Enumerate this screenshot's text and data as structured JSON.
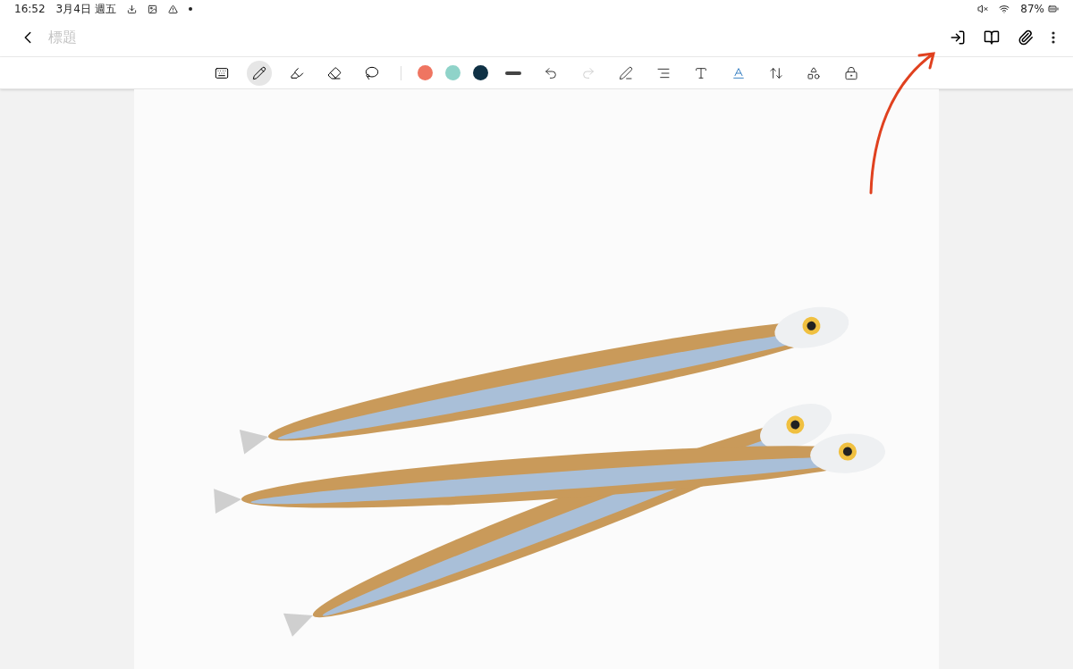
{
  "status_bar": {
    "time": "16:52",
    "date": "3月4日 週五",
    "battery": "87%"
  },
  "header": {
    "title_placeholder": "標題"
  },
  "toolbar": {
    "tools": [
      {
        "kind": "keyboard",
        "selected": false
      },
      {
        "kind": "pen",
        "selected": true
      },
      {
        "kind": "highlighter",
        "selected": false
      },
      {
        "kind": "eraser",
        "selected": false
      },
      {
        "kind": "lasso",
        "selected": false
      }
    ],
    "colors": [
      {
        "color": "#ef7561",
        "selected": false
      },
      {
        "color": "#8fd3c9",
        "selected": false
      },
      {
        "color": "#0f3145",
        "selected": false
      }
    ],
    "actions": [
      {
        "kind": "stroke",
        "disabled": false
      },
      {
        "kind": "undo",
        "disabled": false
      },
      {
        "kind": "redo",
        "disabled": true
      },
      {
        "kind": "pen-settings",
        "disabled": false
      },
      {
        "kind": "align",
        "disabled": false
      },
      {
        "kind": "handwriting",
        "disabled": false
      },
      {
        "kind": "text-style",
        "disabled": false
      },
      {
        "kind": "spacing",
        "disabled": false
      },
      {
        "kind": "shapes",
        "disabled": false
      },
      {
        "kind": "lock",
        "disabled": false
      }
    ]
  }
}
